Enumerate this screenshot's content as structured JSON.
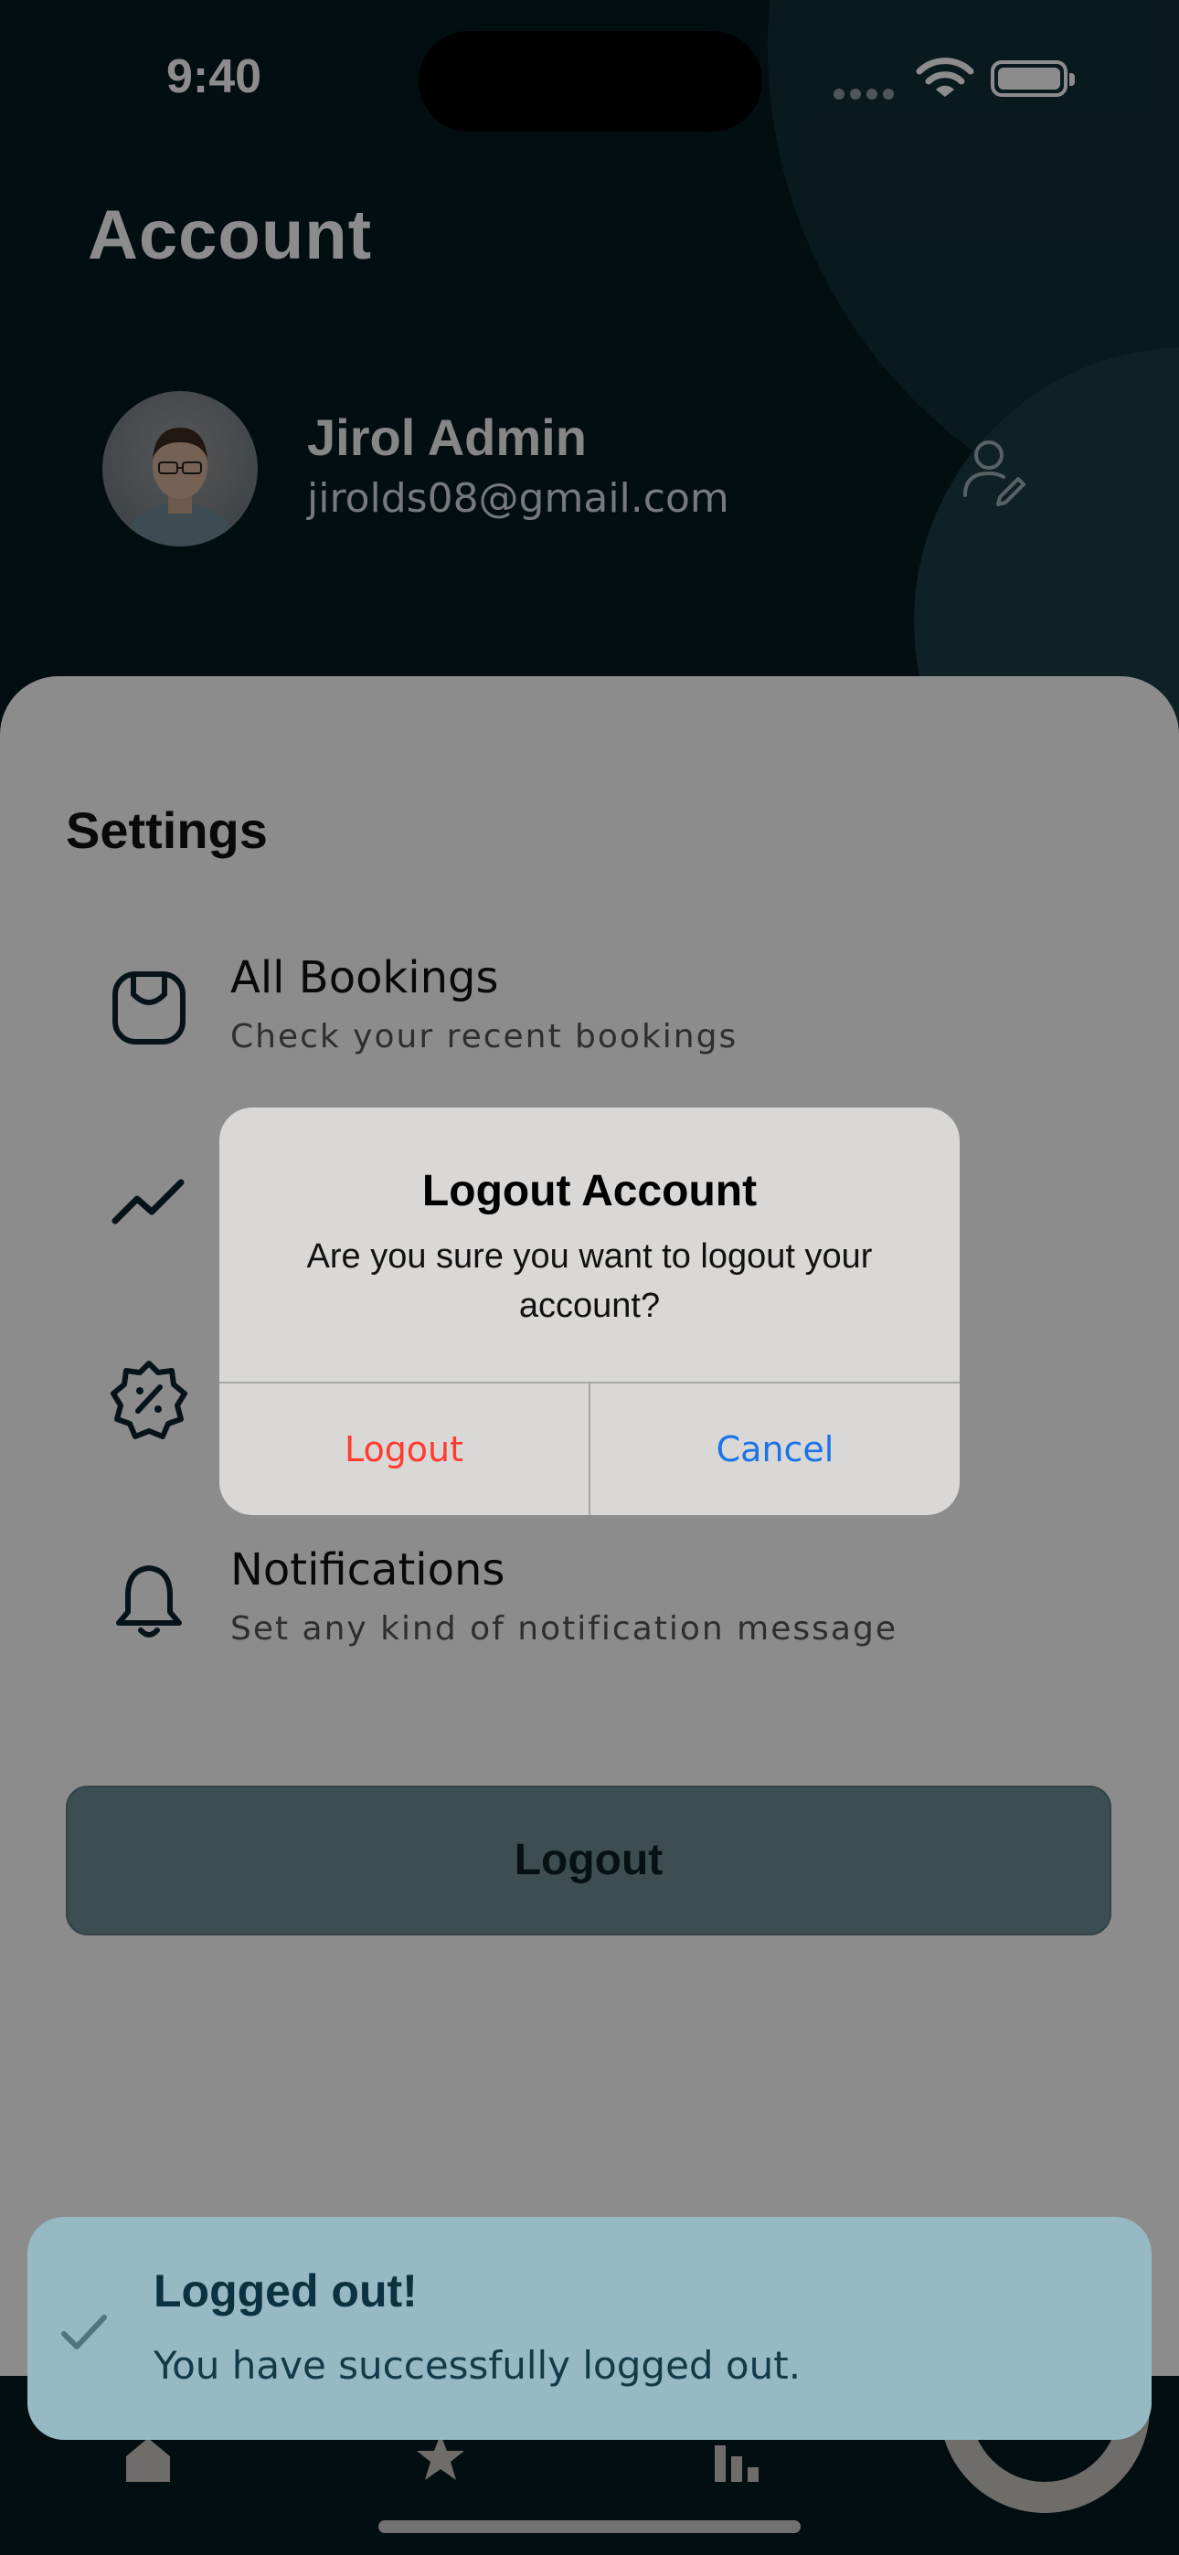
{
  "status_bar": {
    "time": "9:40"
  },
  "header": {
    "title": "Account"
  },
  "profile": {
    "name": "Jirol Admin",
    "email": "jirolds08@gmail.com"
  },
  "settings": {
    "title": "Settings",
    "items": [
      {
        "icon": "shopping-bag-icon",
        "title": "All Bookings",
        "subtitle": "Check your recent bookings"
      },
      {
        "icon": "trend-chart-icon",
        "title": "",
        "subtitle": ""
      },
      {
        "icon": "discount-badge-icon",
        "title": "",
        "subtitle": ""
      },
      {
        "icon": "bell-icon",
        "title": "Notifications",
        "subtitle": "Set any kind of notification message"
      }
    ],
    "logout_label": "Logout"
  },
  "tabbar": {
    "icons": [
      "home-icon",
      "star-icon",
      "bar-chart-icon",
      "profile-icon"
    ]
  },
  "dialog": {
    "title": "Logout Account",
    "message": "Are you sure you want to logout your account?",
    "confirm_label": "Logout",
    "cancel_label": "Cancel",
    "confirm_color": "#ff3b30",
    "cancel_color": "#1a73e8"
  },
  "toast": {
    "icon": "check-icon",
    "title": "Logged out!",
    "message": "You have successfully logged out."
  },
  "colors": {
    "background": "#061a20",
    "toast": "#97b9c4",
    "dialog": "#d9d8d6"
  }
}
